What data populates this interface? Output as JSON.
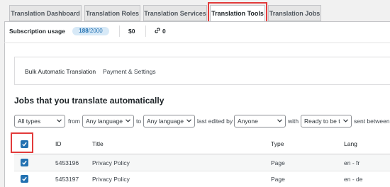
{
  "tabs": [
    {
      "label": "Translation Dashboard",
      "active": false
    },
    {
      "label": "Translation Roles",
      "active": false
    },
    {
      "label": "Translation Services",
      "active": false
    },
    {
      "label": "Translation Tools",
      "active": true
    },
    {
      "label": "Translation Jobs",
      "active": false
    }
  ],
  "usage": {
    "label": "Subscription usage",
    "used": "188",
    "limit": "/2000",
    "cost": "$0",
    "links": "0",
    "icons": [
      "link-icon"
    ]
  },
  "subtabs": [
    {
      "label": "Bulk Automatic Translation",
      "active": true
    },
    {
      "label": "Payment & Settings",
      "active": false
    }
  ],
  "section_title": "Jobs that you translate automatically",
  "filters": {
    "type": "All types",
    "from_label": "from",
    "from_lang": "Any language",
    "to_label": "to",
    "to_lang": "Any language",
    "edited_by_label": "last edited by",
    "editor": "Anyone",
    "with_label": "with",
    "status": "Ready to be t",
    "sent_label": "sent between"
  },
  "table": {
    "headers": {
      "id": "ID",
      "title": "Title",
      "type": "Type",
      "lang": "Lang"
    },
    "rows": [
      {
        "id": "5453196",
        "title": "Privacy Policy",
        "type": "Page",
        "lang": "en - fr",
        "checked": true
      },
      {
        "id": "5453197",
        "title": "Privacy Policy",
        "type": "Page",
        "lang": "en - de",
        "checked": true
      }
    ]
  },
  "colors": {
    "accent": "#2271b1",
    "highlight": "#e23b3b"
  }
}
